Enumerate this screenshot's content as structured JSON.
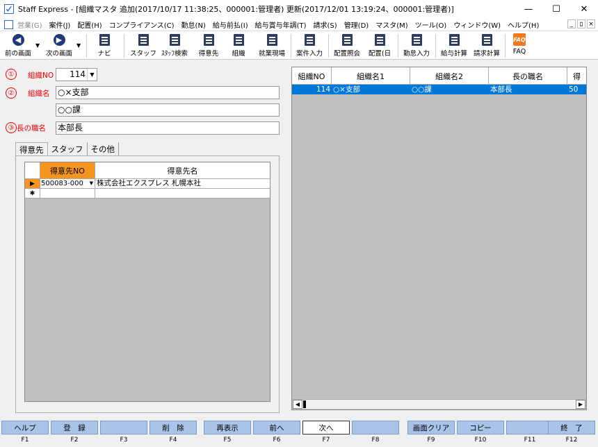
{
  "window": {
    "title": "Staff Express - [組織マスタ 追加(2017/10/17 11:38:25、000001:管理者) 更新(2017/12/01 13:19:24、000001:管理者)]",
    "controls": {
      "minimize": "—",
      "maximize": "☐",
      "close": "✕"
    }
  },
  "menu": {
    "items": [
      {
        "label": "営業(G)",
        "disabled": true
      },
      {
        "label": "案件(J)",
        "disabled": false
      },
      {
        "label": "配置(H)",
        "disabled": false
      },
      {
        "label": "コンプライアンス(C)",
        "disabled": false
      },
      {
        "label": "勤怠(N)",
        "disabled": false
      },
      {
        "label": "給与前払(I)",
        "disabled": false
      },
      {
        "label": "給与賞与年調(T)",
        "disabled": false
      },
      {
        "label": "請求(S)",
        "disabled": false
      },
      {
        "label": "管理(D)",
        "disabled": false
      },
      {
        "label": "マスタ(M)",
        "disabled": false
      },
      {
        "label": "ツール(O)",
        "disabled": false
      },
      {
        "label": "ウィンドウ(W)",
        "disabled": false
      },
      {
        "label": "ヘルプ(H)",
        "disabled": false
      }
    ],
    "mdi": {
      "min": "_",
      "restore": "ﾛ",
      "close": "×"
    }
  },
  "toolbar": {
    "prev": "前の画面",
    "next": "次の画面",
    "navi": "ナビ",
    "staff": "スタッフ",
    "staff_search": "ｽﾀｯﾌ検索",
    "customer": "得意先",
    "org": "組織",
    "worksite": "就業現場",
    "case_entry": "案件入力",
    "placement_inquiry": "配置照会",
    "placement_day": "配置(日",
    "attendance_entry": "勤怠入力",
    "payroll_calc": "給与計算",
    "billing_calc": "請求計算",
    "faq": "FAQ",
    "faq_icon_text": "FAQ"
  },
  "form": {
    "org_no": {
      "marker": "①",
      "label": "組織NO",
      "value": "114"
    },
    "org_name": {
      "marker": "②",
      "label": "組織名",
      "value1": "○×支部",
      "value2": "○○課"
    },
    "head_title": {
      "marker": "③",
      "label": "長の職名",
      "value": "本部長"
    }
  },
  "tabs": [
    {
      "label": "得意先",
      "active": true
    },
    {
      "label": "スタッフ",
      "active": false
    },
    {
      "label": "その他",
      "active": false
    }
  ],
  "subgrid": {
    "headers": [
      "得意先NO",
      "得意先名"
    ],
    "rows": [
      {
        "marker": "▶",
        "code": "500083-000",
        "name": "株式会社エクスプレス 札幌本社"
      },
      {
        "marker": "✱",
        "code": "",
        "name": ""
      }
    ]
  },
  "rightgrid": {
    "headers": [
      "組織NO",
      "組織名1",
      "組織名2",
      "長の職名",
      "得"
    ],
    "rows": [
      {
        "no": "114",
        "name1": "○×支部",
        "name2": "○○課",
        "title": "本部長",
        "extra": "50"
      }
    ]
  },
  "fkeys": [
    {
      "label": "ヘルプ",
      "key": "F1"
    },
    {
      "label": "登　録",
      "key": "F2"
    },
    {
      "label": "",
      "key": "F3"
    },
    {
      "label": "削　除",
      "key": "F4"
    },
    {
      "label": "再表示",
      "key": "F5"
    },
    {
      "label": "前へ",
      "key": "F6"
    },
    {
      "label": "次へ",
      "key": "F7",
      "focused": true
    },
    {
      "label": "",
      "key": "F8"
    },
    {
      "label": "画面クリア",
      "key": "F9"
    },
    {
      "label": "コピー",
      "key": "F10"
    },
    {
      "label": "",
      "key": "F11"
    },
    {
      "label": "終　了",
      "key": "F12"
    }
  ],
  "colors": {
    "accent_orange": "#f7941d",
    "selection_blue": "#0078d7",
    "fkey_blue": "#a9c4e8",
    "label_red": "#e00000"
  }
}
